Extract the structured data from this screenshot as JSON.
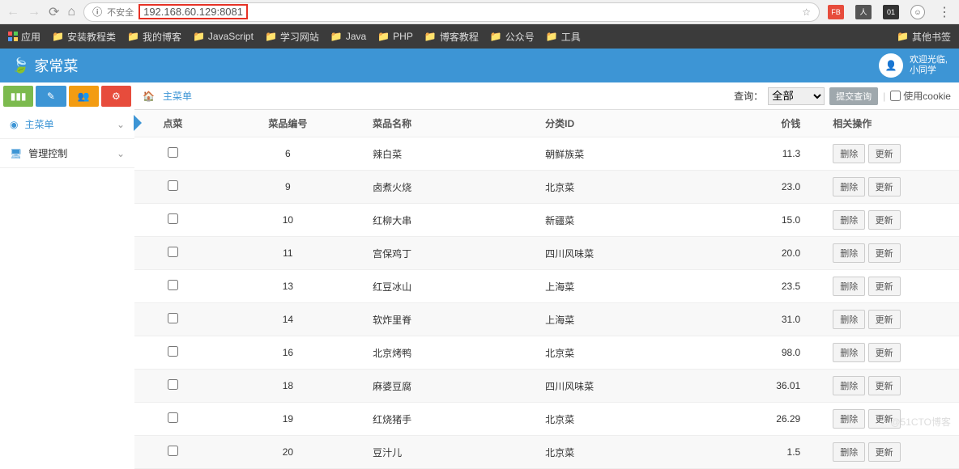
{
  "browser": {
    "insecure_label": "不安全",
    "url": "192.168.60.129:8081",
    "ext1": "FB",
    "ext2": "人",
    "ext3": "01"
  },
  "bookmarks": {
    "apps": "应用",
    "items": [
      "安装教程类",
      "我的博客",
      "JavaScript",
      "学习网站",
      "Java",
      "PHP",
      "博客教程",
      "公众号",
      "工具"
    ],
    "other": "其他书签"
  },
  "app": {
    "title": "家常菜",
    "welcome_line1": "欢迎光临,",
    "welcome_line2": "小同学"
  },
  "breadcrumb": {
    "label": "主菜单"
  },
  "search": {
    "label": "查询：",
    "selected": "全部",
    "submit": "提交查询",
    "cookie_label": "使用cookie"
  },
  "sidebar": {
    "items": [
      {
        "label": "主菜单",
        "icon": "◉",
        "active": true
      },
      {
        "label": "管理控制",
        "icon": "🖥",
        "active": false
      }
    ]
  },
  "table": {
    "headers": {
      "check": "点菜",
      "id": "菜品编号",
      "name": "菜品名称",
      "category": "分类ID",
      "price": "价钱",
      "actions": "相关操作"
    },
    "delete_label": "删除",
    "update_label": "更新",
    "rows": [
      {
        "id": "6",
        "name": "辣白菜",
        "category": "朝鲜族菜",
        "price": "11.3"
      },
      {
        "id": "9",
        "name": "卤煮火烧",
        "category": "北京菜",
        "price": "23.0"
      },
      {
        "id": "10",
        "name": "红柳大串",
        "category": "新疆菜",
        "price": "15.0"
      },
      {
        "id": "11",
        "name": "宫保鸡丁",
        "category": "四川风味菜",
        "price": "20.0"
      },
      {
        "id": "13",
        "name": "红豆冰山",
        "category": "上海菜",
        "price": "23.5"
      },
      {
        "id": "14",
        "name": "软炸里脊",
        "category": "上海菜",
        "price": "31.0"
      },
      {
        "id": "16",
        "name": "北京烤鸭",
        "category": "北京菜",
        "price": "98.0"
      },
      {
        "id": "18",
        "name": "麻婆豆腐",
        "category": "四川风味菜",
        "price": "36.01"
      },
      {
        "id": "19",
        "name": "红烧猪手",
        "category": "北京菜",
        "price": "26.29"
      },
      {
        "id": "20",
        "name": "豆汁儿",
        "category": "北京菜",
        "price": "1.5"
      }
    ]
  },
  "watermark": "@51CTO博客"
}
